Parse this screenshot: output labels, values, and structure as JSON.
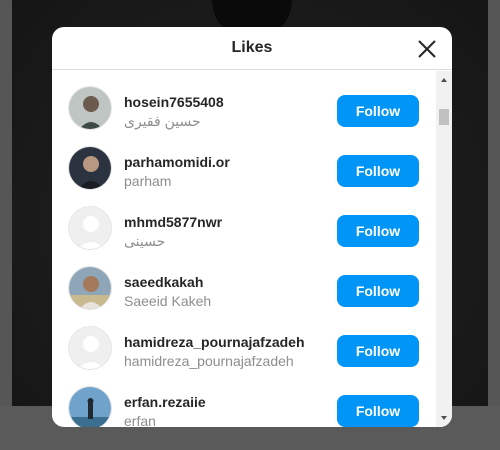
{
  "modal": {
    "title": "Likes",
    "close_icon": "close-icon"
  },
  "users": [
    {
      "username": "hosein7655408",
      "fullname": "حسین فقیری",
      "button": "Follow",
      "avatar": "avatar-photo"
    },
    {
      "username": "parhamomidi.or",
      "fullname": "parham",
      "button": "Follow",
      "avatar": "avatar-photo"
    },
    {
      "username": "mhmd5877nwr",
      "fullname": "حسینی",
      "button": "Follow",
      "avatar": "default-avatar-icon"
    },
    {
      "username": "saeedkakah",
      "fullname": "Saeeid Kakeh",
      "button": "Follow",
      "avatar": "avatar-photo"
    },
    {
      "username": "hamidreza_pournajafzadeh",
      "fullname": "hamidreza_pournajafzadeh",
      "button": "Follow",
      "avatar": "default-avatar-icon"
    },
    {
      "username": "erfan.rezaiie",
      "fullname": "erfan",
      "button": "Follow",
      "avatar": "avatar-photo"
    }
  ],
  "colors": {
    "follow_button": "#0095f6",
    "username_text": "#262626",
    "fullname_text": "#8e8e8e"
  }
}
